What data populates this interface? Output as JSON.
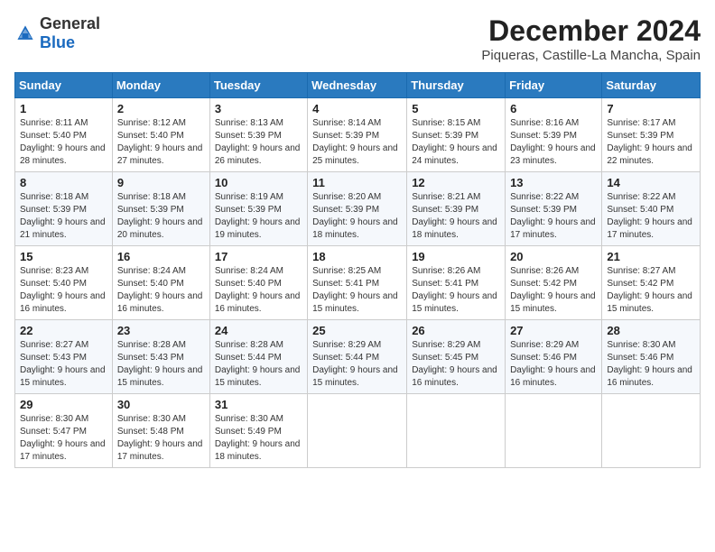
{
  "logo": {
    "general": "General",
    "blue": "Blue"
  },
  "title": "December 2024",
  "location": "Piqueras, Castille-La Mancha, Spain",
  "days_of_week": [
    "Sunday",
    "Monday",
    "Tuesday",
    "Wednesday",
    "Thursday",
    "Friday",
    "Saturday"
  ],
  "weeks": [
    [
      {
        "day": "1",
        "sunrise": "8:11 AM",
        "sunset": "5:40 PM",
        "daylight": "9 hours and 28 minutes."
      },
      {
        "day": "2",
        "sunrise": "8:12 AM",
        "sunset": "5:40 PM",
        "daylight": "9 hours and 27 minutes."
      },
      {
        "day": "3",
        "sunrise": "8:13 AM",
        "sunset": "5:39 PM",
        "daylight": "9 hours and 26 minutes."
      },
      {
        "day": "4",
        "sunrise": "8:14 AM",
        "sunset": "5:39 PM",
        "daylight": "9 hours and 25 minutes."
      },
      {
        "day": "5",
        "sunrise": "8:15 AM",
        "sunset": "5:39 PM",
        "daylight": "9 hours and 24 minutes."
      },
      {
        "day": "6",
        "sunrise": "8:16 AM",
        "sunset": "5:39 PM",
        "daylight": "9 hours and 23 minutes."
      },
      {
        "day": "7",
        "sunrise": "8:17 AM",
        "sunset": "5:39 PM",
        "daylight": "9 hours and 22 minutes."
      }
    ],
    [
      {
        "day": "8",
        "sunrise": "8:18 AM",
        "sunset": "5:39 PM",
        "daylight": "9 hours and 21 minutes."
      },
      {
        "day": "9",
        "sunrise": "8:18 AM",
        "sunset": "5:39 PM",
        "daylight": "9 hours and 20 minutes."
      },
      {
        "day": "10",
        "sunrise": "8:19 AM",
        "sunset": "5:39 PM",
        "daylight": "9 hours and 19 minutes."
      },
      {
        "day": "11",
        "sunrise": "8:20 AM",
        "sunset": "5:39 PM",
        "daylight": "9 hours and 18 minutes."
      },
      {
        "day": "12",
        "sunrise": "8:21 AM",
        "sunset": "5:39 PM",
        "daylight": "9 hours and 18 minutes."
      },
      {
        "day": "13",
        "sunrise": "8:22 AM",
        "sunset": "5:39 PM",
        "daylight": "9 hours and 17 minutes."
      },
      {
        "day": "14",
        "sunrise": "8:22 AM",
        "sunset": "5:40 PM",
        "daylight": "9 hours and 17 minutes."
      }
    ],
    [
      {
        "day": "15",
        "sunrise": "8:23 AM",
        "sunset": "5:40 PM",
        "daylight": "9 hours and 16 minutes."
      },
      {
        "day": "16",
        "sunrise": "8:24 AM",
        "sunset": "5:40 PM",
        "daylight": "9 hours and 16 minutes."
      },
      {
        "day": "17",
        "sunrise": "8:24 AM",
        "sunset": "5:40 PM",
        "daylight": "9 hours and 16 minutes."
      },
      {
        "day": "18",
        "sunrise": "8:25 AM",
        "sunset": "5:41 PM",
        "daylight": "9 hours and 15 minutes."
      },
      {
        "day": "19",
        "sunrise": "8:26 AM",
        "sunset": "5:41 PM",
        "daylight": "9 hours and 15 minutes."
      },
      {
        "day": "20",
        "sunrise": "8:26 AM",
        "sunset": "5:42 PM",
        "daylight": "9 hours and 15 minutes."
      },
      {
        "day": "21",
        "sunrise": "8:27 AM",
        "sunset": "5:42 PM",
        "daylight": "9 hours and 15 minutes."
      }
    ],
    [
      {
        "day": "22",
        "sunrise": "8:27 AM",
        "sunset": "5:43 PM",
        "daylight": "9 hours and 15 minutes."
      },
      {
        "day": "23",
        "sunrise": "8:28 AM",
        "sunset": "5:43 PM",
        "daylight": "9 hours and 15 minutes."
      },
      {
        "day": "24",
        "sunrise": "8:28 AM",
        "sunset": "5:44 PM",
        "daylight": "9 hours and 15 minutes."
      },
      {
        "day": "25",
        "sunrise": "8:29 AM",
        "sunset": "5:44 PM",
        "daylight": "9 hours and 15 minutes."
      },
      {
        "day": "26",
        "sunrise": "8:29 AM",
        "sunset": "5:45 PM",
        "daylight": "9 hours and 16 minutes."
      },
      {
        "day": "27",
        "sunrise": "8:29 AM",
        "sunset": "5:46 PM",
        "daylight": "9 hours and 16 minutes."
      },
      {
        "day": "28",
        "sunrise": "8:30 AM",
        "sunset": "5:46 PM",
        "daylight": "9 hours and 16 minutes."
      }
    ],
    [
      {
        "day": "29",
        "sunrise": "8:30 AM",
        "sunset": "5:47 PM",
        "daylight": "9 hours and 17 minutes."
      },
      {
        "day": "30",
        "sunrise": "8:30 AM",
        "sunset": "5:48 PM",
        "daylight": "9 hours and 17 minutes."
      },
      {
        "day": "31",
        "sunrise": "8:30 AM",
        "sunset": "5:49 PM",
        "daylight": "9 hours and 18 minutes."
      },
      null,
      null,
      null,
      null
    ]
  ]
}
